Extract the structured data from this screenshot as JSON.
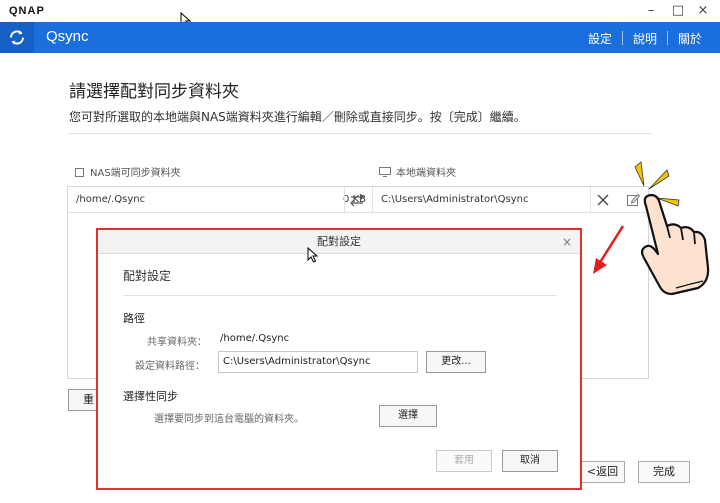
{
  "window": {
    "brand": "QNAP",
    "minimize_glyph": "–",
    "maximize_glyph": "□",
    "close_glyph": "×"
  },
  "header": {
    "app_icon": "sync-icon",
    "title": "Qsync",
    "nav": [
      "設定",
      "說明",
      "關於"
    ],
    "bg_color": "#1a6fdc"
  },
  "main": {
    "heading": "請選擇配對同步資料夾",
    "description": "您可對所選取的本地端與NAS端資料夾進行編輯／刪除或直接同步。按〔完成〕繼續。",
    "nas_column_label": "NAS端可同步資料夾",
    "local_column_label": "本地端資料夾",
    "row": {
      "nas_path": "/home/.Qsync",
      "size": "0 KB",
      "swap_icon": "swap-arrows-icon",
      "local_path": "C:\\Users\\Administrator\\Qsync",
      "delete_icon": "close-icon",
      "edit_icon": "edit-icon"
    },
    "left_button_label": "重",
    "back_button": "<返回",
    "done_button": "完成"
  },
  "dialog": {
    "title": "配對設定",
    "close_glyph": "×",
    "heading": "配對設定",
    "path_section": "路徑",
    "shared_folder_label": "共享資料夾：",
    "shared_folder_value": "/home/.Qsync",
    "set_path_label": "設定資料路徑：",
    "set_path_value": "C:\\Users\\Administrator\\Qsync",
    "change_button": "更改...",
    "selective_section": "選擇性同步",
    "selective_desc": "選擇要同步到這台電腦的資料夾。",
    "select_button": "選擇",
    "apply_button": "套用",
    "cancel_button": "取消",
    "border_color": "#e03030"
  },
  "annotation": {
    "pointer": "pointing-hand-icon",
    "arrow": "red-arrow-icon",
    "accent_color": "#f5c400"
  }
}
